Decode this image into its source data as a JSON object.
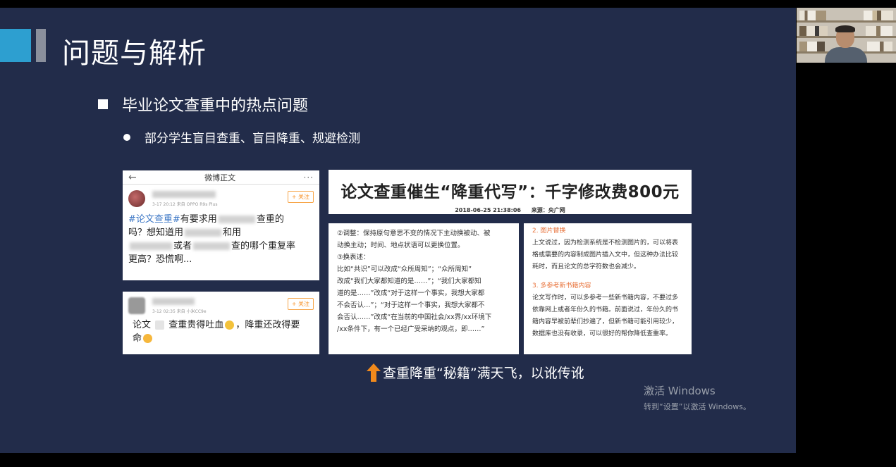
{
  "slide": {
    "title": "问题与解析",
    "bullet1": "毕业论文查重中的热点问题",
    "bullet2": "部分学生盲目查重、盲目降重、规避检测",
    "caption": "查重降重“秘籍”满天飞，以讹传讹"
  },
  "weibo1": {
    "header": "微博正文",
    "meta": "3-17 20:12  来自 OPPO R9s Plus",
    "follow": "+ 关注",
    "tag": "#论文查重#",
    "t1": "有要求用",
    "t2": "查重的",
    "t3": "吗？想知道用",
    "t4": "和用",
    "t5": "或者",
    "t6": "查的哪个重复率",
    "t7": "更高？恐慌啊..."
  },
  "weibo2": {
    "meta": "3-12 02:35  来自 小米CC9e",
    "follow": "+ 关注",
    "p1": "论文",
    "p2": "查重贵得吐血",
    "p3": "，降重还改得要",
    "p4": "命"
  },
  "news": {
    "headline": "论文查重催生“降重代写”：千字修改费800元",
    "date": "2018-06-25 21:38:06",
    "source": "来源：央广网"
  },
  "tip1": {
    "lines": [
      "②调整：保持原句意思不变的情况下主动换被动、被",
      "动换主动；时间、地点状语可以更换位置。",
      "③换表述：",
      "比如“共识”可以改成“众所周知”；“众所周知”",
      "改成“我们大家都知道的是……”；“我们大家都知",
      "道的是……”改成“对于这样一个事实，我想大家都",
      "不会否认…”；“对于这样一个事实，我想大家都不",
      "会否认……”改成“在当前的中国社会/xx界/xx环境下",
      "/xx条件下，有一个已经广受采纳的观点，即……”"
    ]
  },
  "tip2": {
    "h1": "2. 图片替换",
    "b1": [
      "上文说过，因为检测系统是不检测图片的，可以将表",
      "格或需要的内容制成图片插入文中，但这种办法比较",
      "耗时，而且论文的总字符数也会减少。"
    ],
    "h2": "3. 多参考新书籍内容",
    "b2": [
      "论文写作时，可以多参考一些新书籍内容，不要过多",
      "依靠网上或者年份久的书籍。前面说过，年份久的书",
      "籍内容早被前辈们抄遍了，但新书籍可能引用较少，",
      "数据库也没有收录，可以很好的帮你降低查重率。"
    ]
  },
  "watermark": {
    "line1": "激活 Windows",
    "line2": "转到“设置”以激活 Windows。"
  },
  "colors": {
    "slide_bg": "#222c4a",
    "accent_blue": "#2d9fd0",
    "orange_arrow": "#f28a1c",
    "weibo_tag": "#3e78c6",
    "tip_heading": "#e8723a"
  }
}
